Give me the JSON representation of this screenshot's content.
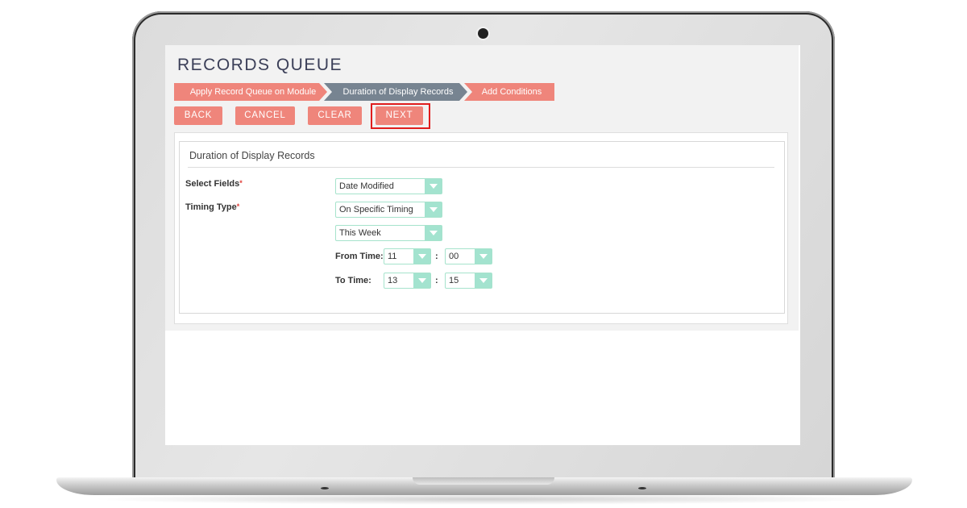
{
  "app": {
    "page_title": "RECORDS QUEUE",
    "wizard_steps": [
      {
        "label": "Apply Record Queue on Module",
        "state": "completed"
      },
      {
        "label": "Duration of Display Records",
        "state": "active"
      },
      {
        "label": "Add Conditions",
        "state": "upcoming"
      }
    ],
    "buttons": {
      "back": "BACK",
      "cancel": "CANCEL",
      "clear": "CLEAR",
      "next": "NEXT"
    },
    "highlighted_button": "next",
    "panel": {
      "title": "Duration of Display Records",
      "select_fields": {
        "label": "Select Fields",
        "required_mark": "*",
        "value": "Date Modified"
      },
      "timing_type": {
        "label": "Timing Type",
        "required_mark": "*",
        "value": "On Specific Timing"
      },
      "period": {
        "value": "This Week"
      },
      "from_time": {
        "label": "From Time:",
        "hour": "11",
        "minute": "00",
        "separator": ":"
      },
      "to_time": {
        "label": "To Time:",
        "hour": "13",
        "minute": "15",
        "separator": ":"
      }
    }
  },
  "colors": {
    "accent": "#ef857b",
    "active_step": "#778491",
    "select_border": "#a6e3cc",
    "select_arrow": "#a3e3cf",
    "highlight_box": "#e01d1d",
    "title_text": "#3b3f58"
  }
}
